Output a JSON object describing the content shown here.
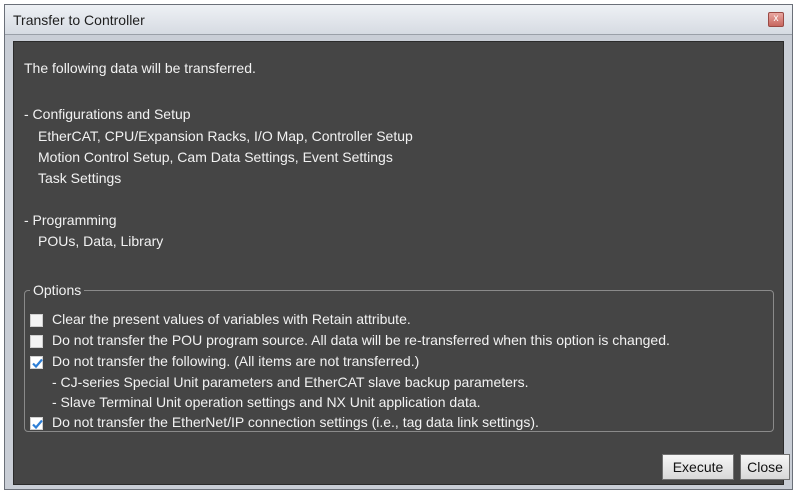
{
  "window": {
    "title": "Transfer to Controller",
    "close_glyph": "x"
  },
  "intro": "The following data will be transferred.",
  "sections": [
    {
      "heading": "- Configurations and Setup",
      "lines": [
        "EtherCAT, CPU/Expansion Racks, I/O Map, Controller Setup",
        "Motion Control Setup, Cam Data Settings, Event Settings",
        "Task Settings"
      ]
    },
    {
      "heading": "- Programming",
      "lines": [
        "POUs, Data, Library"
      ]
    }
  ],
  "options": {
    "legend": "Options",
    "items": [
      {
        "label": "Clear the present values of variables with Retain attribute.",
        "checked": false
      },
      {
        "label": "Do not transfer the POU program source. All data will be re-transferred when this option is changed.",
        "checked": false
      },
      {
        "label": "Do not transfer the following. (All items are not transferred.)",
        "checked": true,
        "sublines": [
          "- CJ-series Special Unit parameters and EtherCAT slave backup parameters.",
          "- Slave Terminal Unit operation settings and NX Unit application data."
        ]
      },
      {
        "label": "Do not transfer the EtherNet/IP connection settings (i.e., tag data link settings).",
        "checked": true
      }
    ]
  },
  "buttons": {
    "execute": "Execute",
    "close": "Close"
  },
  "colors": {
    "content_bg": "#454545",
    "text": "#f2f2f2",
    "check": "#2e7fd6"
  }
}
